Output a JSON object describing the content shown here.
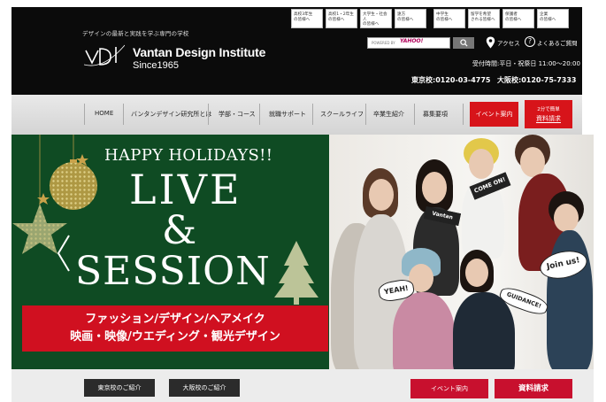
{
  "header": {
    "tagline": "デザインの最新と実践を学ぶ専門の学校",
    "brand_name": "Vantan Design Institute",
    "brand_since": "Since1965",
    "quick_links": [
      {
        "line1": "高校3年生",
        "line2": "の皆様へ"
      },
      {
        "line1": "高校1・2年生",
        "line2": "の皆様へ"
      },
      {
        "line1": "大学生・社会人",
        "line2": "の皆様へ"
      },
      {
        "line1": "遠方",
        "line2": "の皆様へ"
      },
      {
        "line1": "中学生",
        "line2": "の皆様へ"
      },
      {
        "line1": "留学を希望",
        "line2": "される皆様へ"
      },
      {
        "line1": "保護者",
        "line2": "の皆様へ"
      },
      {
        "line1": "企業",
        "line2": "の皆様へ"
      }
    ],
    "search_powered": "POWERED BY",
    "search_brand": "YAHOO!",
    "access_label": "アクセス",
    "faq_label": "よくあるご質問",
    "hours": "受付時間:平日・祝祭日 11:00～20:00",
    "tel_tokyo": "東京校:0120-03-4775",
    "tel_osaka": "大阪校:0120-75-7333"
  },
  "nav": {
    "items": [
      "HOME",
      "バンタンデザイン研究所とは",
      "学部・コース",
      "就職サポート",
      "スクールライフ",
      "卒業生紹介",
      "募集要項"
    ],
    "event_button": "イベント案内",
    "request_line1": "2分で簡単",
    "request_line2": "資料請求"
  },
  "hero": {
    "happy_holidays": "HAPPY HOLIDAYS!!",
    "live": "LIVE",
    "amp": "&",
    "session": "SESSION",
    "ribbon_line1": "ファッション/デザイン/ヘアメイク",
    "ribbon_line2": "映画・映像/ウエディング・観光デザイン",
    "signs": {
      "come_on": "COME ON!",
      "join_us": "Join us!",
      "yeah": "YEAH!",
      "guidance": "GUIDANCE!",
      "vantan": "Vantan"
    },
    "colors": {
      "green": "#0f4b23",
      "red": "#d01020"
    }
  },
  "bottom": {
    "tokyo": "東京校のご紹介",
    "osaka": "大阪校のご紹介",
    "event": "イベント案内",
    "request": "資料請求"
  }
}
